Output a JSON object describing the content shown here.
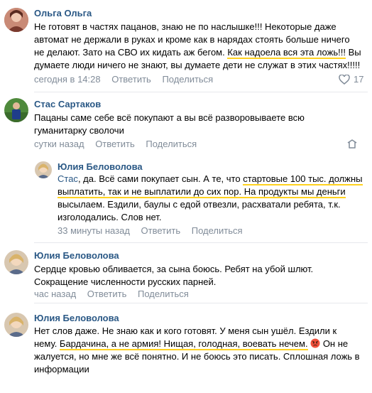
{
  "comments": [
    {
      "author": "Ольга Ольга",
      "lines": [
        "Не готовят в частях пацанов, знаю не по наслышке!!! Некоторые даже",
        "автомат не держали в руках и кроме как в нарядах стоять больше ничего",
        "не делают. Зато на СВО их кидать аж бегом.",
        "Как надоела вся эта ложь!!!",
        " Вы",
        "думаете люди ничего не знают, вы думаете дети не служат в этих частях!!!!!"
      ],
      "time": "сегодня в 14:28",
      "reply": "Ответить",
      "share": "Поделиться",
      "likes": "17"
    },
    {
      "author": "Стас Сартаков",
      "lines": [
        "Пацаны саме себе всё покупают а вы всё разворовываете всю",
        "гуманитарку сволочи"
      ],
      "time": "сутки назад",
      "reply": "Ответить",
      "share": "Поделиться"
    },
    {
      "author": "Юлия Беловолова",
      "reply_to": "Стас",
      "lines": [
        ", да. Всё сами покупает сын. А те, что ",
        "стартовые 100 тыс. должны",
        "выплатить, так и не выплатили до сих пор. На продукты мы деньги",
        "высылаем. Ездили, баулы с едой отвезли, расхватали ребята, т.к.",
        "изголодались. Слов нет."
      ],
      "time": "33 минуты назад",
      "reply": "Ответить",
      "share": "Поделиться"
    },
    {
      "author": "Юлия Беловолова",
      "lines": [
        "Сердце кровью обливается, за сына боюсь. Ребят на убой шлют.",
        "Сокращение численности русских парней."
      ],
      "time": "час назад",
      "reply": "Ответить",
      "share": "Поделиться"
    },
    {
      "author": "Юлия Беловолова",
      "lines": [
        "Нет слов даже. Не знаю как и кого готовят. У меня сын ушёл. Ездили к",
        "нему. ",
        "Бардачина, а не армия! Нищая, голодная, воевать нечем.",
        " Он не",
        "жалуется, но мне же всё понятно. И не боюсь это писать. Сплошная ложь в",
        "информации"
      ],
      "time": "час назад",
      "reply": "Ответить",
      "share": "Поделиться"
    }
  ],
  "colors": {
    "author": "#2a5885",
    "meta": "#818c99",
    "highlight": "#ffd21f",
    "divider": "#e7e8ec"
  }
}
